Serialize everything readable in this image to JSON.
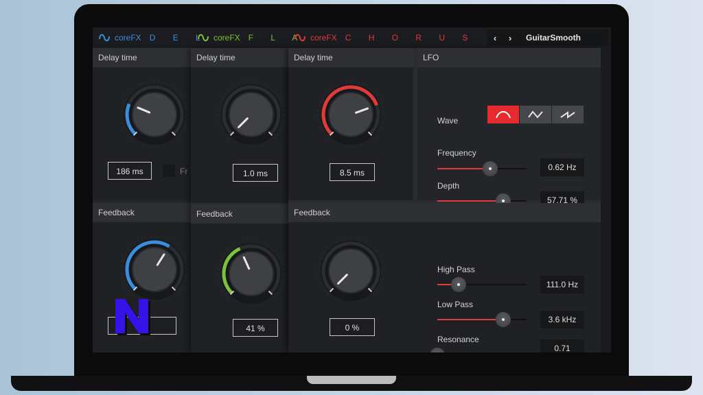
{
  "tabs": [
    {
      "brand": "coreFX",
      "fx": "D E L",
      "color": "#3a8fdc"
    },
    {
      "brand": "coreFX",
      "fx": "F L A",
      "color": "#7cc23a"
    },
    {
      "brand": "coreFX",
      "fx": "C H O R U S",
      "color": "#e23a3a"
    }
  ],
  "nav": {
    "prev": "‹",
    "next": "›",
    "preset": "GuitarSmooth"
  },
  "delay_panel": {
    "delay_title": "Delay time",
    "delay_value": "186 ms",
    "delay_level": 0.25,
    "free_label": "Fr",
    "feedback_title": "Feedback",
    "feedback_value": "7 %",
    "feedback_level": 0.62,
    "accent": "#3a8fdc"
  },
  "flanger_panel": {
    "delay_title": "Delay time",
    "delay_value": "1.0 ms",
    "delay_level": 0.0,
    "feedback_title": "Feedback",
    "feedback_value": "41 %",
    "feedback_level": 0.41,
    "accent": "#7cc23a"
  },
  "chorus_panel": {
    "delay_title": "Delay time",
    "delay_value": "8.5 ms",
    "delay_level": 0.76,
    "feedback_title": "Feedback",
    "feedback_value": "0 %",
    "feedback_level": 0.0,
    "accent": "#e23a3a",
    "lfo": {
      "title": "LFO",
      "wave_label": "Wave",
      "wave_options": [
        "sine-wave-icon",
        "triangle-wave-icon",
        "sawtooth-wave-icon"
      ],
      "wave_selected": 0,
      "frequency_label": "Frequency",
      "frequency_value": "0.62 Hz",
      "frequency_level": 0.59,
      "depth_label": "Depth",
      "depth_value": "57.71 %",
      "depth_level": 0.74
    },
    "filters": {
      "highpass_label": "High Pass",
      "highpass_value": "111.0 Hz",
      "highpass_level": 0.24,
      "lowpass_label": "Low Pass",
      "lowpass_value": "3.6 kHz",
      "lowpass_level": 0.74,
      "resonance_label": "Resonance",
      "resonance_value": "0.71",
      "resonance_level": 0.0
    }
  },
  "overlay_logo": {
    "letter": "N",
    "fill": "#3512e6",
    "shadow": "#0c0c0c"
  }
}
